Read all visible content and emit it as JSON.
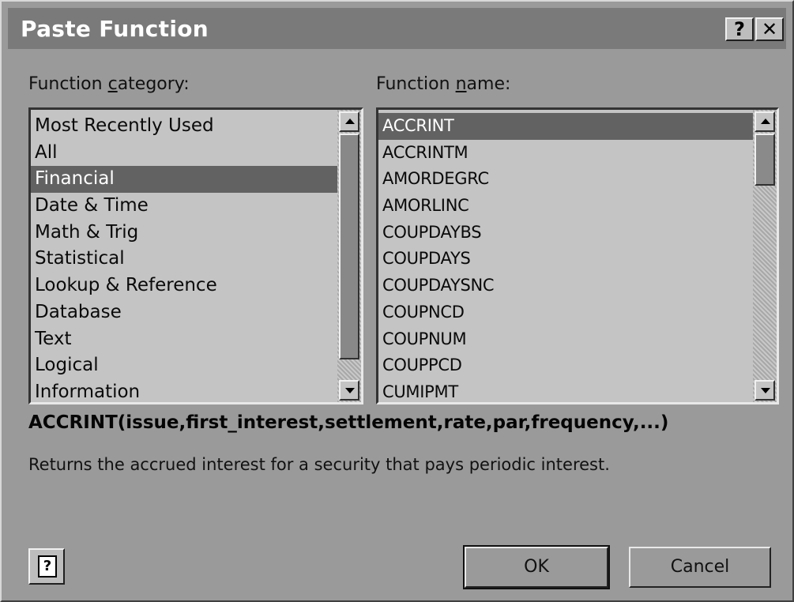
{
  "window": {
    "title": "Paste Function",
    "help_glyph": "?",
    "close_glyph": "✕"
  },
  "category_list": {
    "label_prefix": "Function ",
    "label_accel": "c",
    "label_suffix": "ategory:",
    "items": [
      "Most Recently Used",
      "All",
      "Financial",
      "Date & Time",
      "Math & Trig",
      "Statistical",
      "Lookup & Reference",
      "Database",
      "Text",
      "Logical",
      "Information"
    ],
    "selected": "Financial"
  },
  "function_list": {
    "label_prefix": "Function ",
    "label_accel": "n",
    "label_suffix": "ame:",
    "items": [
      "ACCRINT",
      "ACCRINTM",
      "AMORDEGRC",
      "AMORLINC",
      "COUPDAYBS",
      "COUPDAYS",
      "COUPDAYSNC",
      "COUPNCD",
      "COUPNUM",
      "COUPPCD",
      "CUMIPMT"
    ],
    "selected": "ACCRINT"
  },
  "syntax": "ACCRINT(issue,first_interest,settlement,rate,par,frequency,...)",
  "description": "Returns the accrued interest for a security that pays periodic interest.",
  "buttons": {
    "ok": "OK",
    "cancel": "Cancel",
    "assistant_glyph": "?"
  },
  "icons": {
    "help": "help-question-icon",
    "close": "close-icon",
    "assistant": "office-assistant-icon"
  }
}
